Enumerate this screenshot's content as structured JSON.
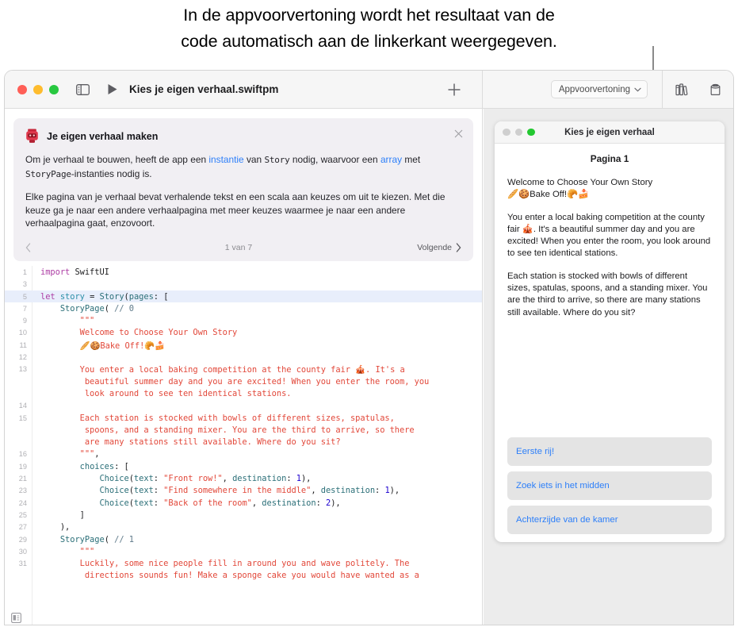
{
  "caption": {
    "line1": "In de appvoorvertoning wordt het resultaat van de",
    "line2": "code automatisch aan de linkerkant weergegeven."
  },
  "toolbar": {
    "sidebar_toggle_icon": "sidebar-toggle-icon",
    "run_icon": "run-triangle-icon",
    "document_title": "Kies je eigen verhaal.swiftpm",
    "add_icon": "plus-icon",
    "preview_mode_label": "Appvoorvertoning",
    "preview_mode_chevron": "chevron-down-icon",
    "library_icon": "library-books-icon",
    "modules_icon": "package-cylinder-icon"
  },
  "info_card": {
    "emoji": "robot-face-icon",
    "title": "Je eigen verhaal maken",
    "close_icon": "close-icon",
    "paragraph1": {
      "a": "Om je verhaal te bouwen, heeft de app een ",
      "link1": "instantie",
      "b": " van ",
      "code1": "Story",
      "c": " nodig, waarvoor een ",
      "link2": "array",
      "d": " met ",
      "code2": "StoryPage",
      "e": "-instanties nodig is."
    },
    "paragraph2": "Elke pagina van je verhaal bevat verhalende tekst en een scala aan keuzes om uit te kiezen. Met die keuze ga je naar een andere verhaalpagina met meer keuzes waarmee je naar een andere verhaalpagina gaat, enzovoort.",
    "prev_icon": "chevron-left-icon",
    "page_count": "1 van 7",
    "next_label": "Volgende",
    "next_icon": "chevron-right-icon"
  },
  "code": {
    "bottom_icon": "editor-options-icon",
    "lines": [
      {
        "no": "1",
        "indent": 0,
        "hl": false,
        "tokens": [
          {
            "t": "kw",
            "v": "import"
          },
          {
            "t": "pln",
            "v": " SwiftUI"
          }
        ]
      },
      {
        "no": "3",
        "indent": 0,
        "hl": false,
        "tokens": []
      },
      {
        "no": "5",
        "indent": 0,
        "hl": true,
        "tokens": [
          {
            "t": "kw",
            "v": "let"
          },
          {
            "t": "pln",
            "v": " "
          },
          {
            "t": "var",
            "v": "story"
          },
          {
            "t": "pln",
            "v": " = "
          },
          {
            "t": "typ",
            "v": "Story"
          },
          {
            "t": "pln",
            "v": "("
          },
          {
            "t": "par",
            "v": "pages"
          },
          {
            "t": "pln",
            "v": ": ["
          }
        ]
      },
      {
        "no": "7",
        "indent": 0,
        "hl": false,
        "tokens": [
          {
            "t": "pln",
            "v": "    "
          },
          {
            "t": "typ",
            "v": "StoryPage"
          },
          {
            "t": "pln",
            "v": "( "
          },
          {
            "t": "cmt",
            "v": "// 0"
          }
        ]
      },
      {
        "no": "9",
        "indent": 0,
        "hl": false,
        "tokens": [
          {
            "t": "str",
            "v": "        \"\"\""
          }
        ]
      },
      {
        "no": "10",
        "indent": 0,
        "hl": false,
        "tokens": [
          {
            "t": "str",
            "v": "        Welcome to Choose Your Own Story"
          }
        ]
      },
      {
        "no": "11",
        "indent": 0,
        "hl": false,
        "tokens": [
          {
            "t": "str",
            "v": "        🥖🍪Bake Off!🥐🍰"
          }
        ]
      },
      {
        "no": "12",
        "indent": 0,
        "hl": false,
        "tokens": []
      },
      {
        "no": "13",
        "indent": 0,
        "hl": false,
        "tokens": [
          {
            "t": "str",
            "v": "        You enter a local baking competition at the county fair 🎪. It's a"
          }
        ]
      },
      {
        "no": "",
        "indent": 0,
        "hl": false,
        "tokens": [
          {
            "t": "str",
            "v": "         beautiful summer day and you are excited! When you enter the room, you"
          }
        ]
      },
      {
        "no": "",
        "indent": 0,
        "hl": false,
        "tokens": [
          {
            "t": "str",
            "v": "         look around to see ten identical stations."
          }
        ]
      },
      {
        "no": "14",
        "indent": 0,
        "hl": false,
        "tokens": []
      },
      {
        "no": "15",
        "indent": 0,
        "hl": false,
        "tokens": [
          {
            "t": "str",
            "v": "        Each station is stocked with bowls of different sizes, spatulas,"
          }
        ]
      },
      {
        "no": "",
        "indent": 0,
        "hl": false,
        "tokens": [
          {
            "t": "str",
            "v": "         spoons, and a standing mixer. You are the third to arrive, so there"
          }
        ]
      },
      {
        "no": "",
        "indent": 0,
        "hl": false,
        "tokens": [
          {
            "t": "str",
            "v": "         are many stations still available. Where do you sit?"
          }
        ]
      },
      {
        "no": "16",
        "indent": 0,
        "hl": false,
        "tokens": [
          {
            "t": "str",
            "v": "        \"\"\""
          },
          {
            "t": "pln",
            "v": ","
          }
        ]
      },
      {
        "no": "19",
        "indent": 0,
        "hl": false,
        "tokens": [
          {
            "t": "pln",
            "v": "        "
          },
          {
            "t": "par",
            "v": "choices"
          },
          {
            "t": "pln",
            "v": ": ["
          }
        ]
      },
      {
        "no": "21",
        "indent": 0,
        "hl": false,
        "tokens": [
          {
            "t": "pln",
            "v": "            "
          },
          {
            "t": "typ",
            "v": "Choice"
          },
          {
            "t": "pln",
            "v": "("
          },
          {
            "t": "par",
            "v": "text"
          },
          {
            "t": "pln",
            "v": ": "
          },
          {
            "t": "str",
            "v": "\"Front row!\""
          },
          {
            "t": "pln",
            "v": ", "
          },
          {
            "t": "par",
            "v": "destination"
          },
          {
            "t": "pln",
            "v": ": "
          },
          {
            "t": "num",
            "v": "1"
          },
          {
            "t": "pln",
            "v": "),"
          }
        ]
      },
      {
        "no": "23",
        "indent": 0,
        "hl": false,
        "tokens": [
          {
            "t": "pln",
            "v": "            "
          },
          {
            "t": "typ",
            "v": "Choice"
          },
          {
            "t": "pln",
            "v": "("
          },
          {
            "t": "par",
            "v": "text"
          },
          {
            "t": "pln",
            "v": ": "
          },
          {
            "t": "str",
            "v": "\"Find somewhere in the middle\""
          },
          {
            "t": "pln",
            "v": ", "
          },
          {
            "t": "par",
            "v": "destination"
          },
          {
            "t": "pln",
            "v": ": "
          },
          {
            "t": "num",
            "v": "1"
          },
          {
            "t": "pln",
            "v": "),"
          }
        ]
      },
      {
        "no": "24",
        "indent": 0,
        "hl": false,
        "tokens": [
          {
            "t": "pln",
            "v": "            "
          },
          {
            "t": "typ",
            "v": "Choice"
          },
          {
            "t": "pln",
            "v": "("
          },
          {
            "t": "par",
            "v": "text"
          },
          {
            "t": "pln",
            "v": ": "
          },
          {
            "t": "str",
            "v": "\"Back of the room\""
          },
          {
            "t": "pln",
            "v": ", "
          },
          {
            "t": "par",
            "v": "destination"
          },
          {
            "t": "pln",
            "v": ": "
          },
          {
            "t": "num",
            "v": "2"
          },
          {
            "t": "pln",
            "v": "),"
          }
        ]
      },
      {
        "no": "25",
        "indent": 0,
        "hl": false,
        "tokens": [
          {
            "t": "pln",
            "v": "        ]"
          }
        ]
      },
      {
        "no": "27",
        "indent": 0,
        "hl": false,
        "tokens": [
          {
            "t": "pln",
            "v": "    ),"
          }
        ]
      },
      {
        "no": "29",
        "indent": 0,
        "hl": false,
        "tokens": [
          {
            "t": "pln",
            "v": "    "
          },
          {
            "t": "typ",
            "v": "StoryPage"
          },
          {
            "t": "pln",
            "v": "( "
          },
          {
            "t": "cmt",
            "v": "// 1"
          }
        ]
      },
      {
        "no": "30",
        "indent": 0,
        "hl": false,
        "tokens": [
          {
            "t": "str",
            "v": "        \"\"\""
          }
        ]
      },
      {
        "no": "31",
        "indent": 0,
        "hl": false,
        "tokens": [
          {
            "t": "str",
            "v": "        Luckily, some nice people fill in around you and wave politely. The"
          }
        ]
      },
      {
        "no": "",
        "indent": 0,
        "hl": false,
        "tokens": [
          {
            "t": "str",
            "v": "         directions sounds fun! Make a sponge cake you would have wanted as a"
          }
        ]
      }
    ]
  },
  "preview": {
    "window_title": "Kies je eigen verhaal",
    "dots": [
      "close-dot",
      "minimize-dot",
      "live-dot"
    ],
    "page_label": "Pagina 1",
    "paragraphs": [
      "Welcome to Choose Your Own Story\n🥖🍪Bake Off!🥐🍰",
      "You enter a local baking competition at the county fair 🎪. It's a beautiful summer day and you are excited! When you enter the room, you look around to see ten identical stations.",
      "Each station is stocked with bowls of different sizes, spatulas, spoons, and a standing mixer. You are the third to arrive, so there are many stations still available. Where do you sit?"
    ],
    "choices": [
      "Eerste rij!",
      "Zoek iets in het midden",
      "Achterzijde van de kamer"
    ]
  },
  "colors": {
    "accent_link": "#2d7ff9",
    "string_red": "#e2483a",
    "keyword_magenta": "#ad3da4",
    "type_teal": "#2b6f78",
    "number_blue": "#1c00cf",
    "live_green": "#23c831",
    "highlight_blue": "#e8eefb"
  }
}
